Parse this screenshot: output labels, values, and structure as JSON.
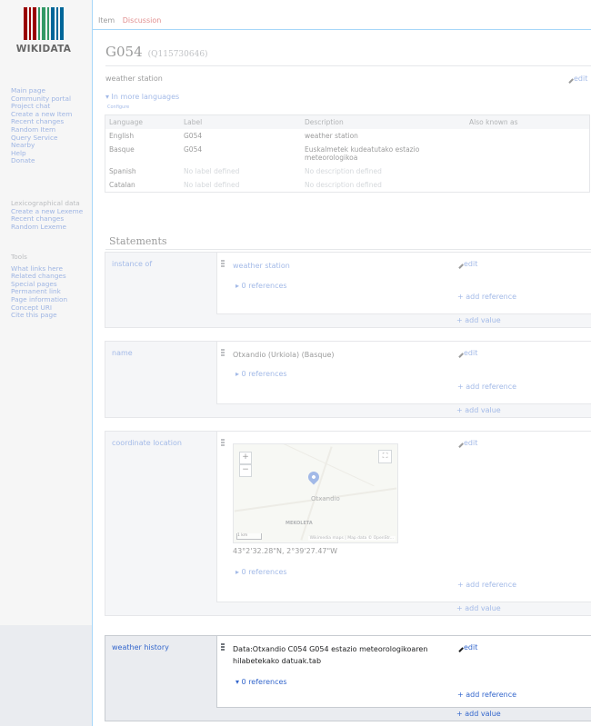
{
  "sidebar": {
    "logo_text": "WIKIDATA",
    "logo_colors": [
      "#990000",
      "#339966",
      "#006699"
    ],
    "nav_main": [
      "Main page",
      "Community portal",
      "Project chat",
      "Create a new Item",
      "Recent changes",
      "Random Item",
      "Query Service",
      "Nearby",
      "Help",
      "Donate"
    ],
    "lexico_heading": "Lexicographical data",
    "nav_lexico": [
      "Create a new Lexeme",
      "Recent changes",
      "Random Lexeme"
    ],
    "tools_heading": "Tools",
    "nav_tools": [
      "What links here",
      "Related changes",
      "Special pages",
      "Permanent link",
      "Page information",
      "Concept URI",
      "Cite this page"
    ]
  },
  "tabs": {
    "item": "Item",
    "discussion": "Discussion"
  },
  "header": {
    "label": "G054",
    "qid": "(Q115730646)"
  },
  "description": "weather station",
  "edit_label": "edit",
  "in_more_languages": "▾ In more languages",
  "configure": "Configure",
  "languages_table": {
    "headers": [
      "Language",
      "Label",
      "Description",
      "Also known as"
    ],
    "rows": [
      {
        "language": "English",
        "label": "G054",
        "description": "weather station",
        "aliases": ""
      },
      {
        "language": "Basque",
        "label": "G054",
        "description": "Euskalmetek kudeatutako estazio meteorologikoa",
        "aliases": ""
      },
      {
        "language": "Spanish",
        "label": "No label defined",
        "description": "No description defined",
        "aliases": ""
      },
      {
        "language": "Catalan",
        "label": "No label defined",
        "description": "No description defined",
        "aliases": ""
      }
    ]
  },
  "statements_heading": "Statements",
  "statements": {
    "instance_of": {
      "property": "instance of",
      "value": "weather station",
      "refs": "▸ 0 references"
    },
    "name": {
      "property": "name",
      "value": "Otxandio (Urkiola) (Basque)",
      "refs": "▸ 0 references"
    },
    "coordinate_location": {
      "property": "coordinate location",
      "value": "43°2'32.28\"N, 2°39'27.47\"W",
      "refs": "▸ 0 references",
      "map": {
        "town": "Otxandio",
        "town2": "MEKOLETA",
        "scale": "1 km",
        "attribution": "Wikimedia maps | Map data © OpenStr..."
      }
    },
    "weather_history": {
      "property": "weather history",
      "value": "Data:Otxandio C054 G054 estazio meteorologikoaren hilabetekako datuak.tab",
      "refs": "▾ 0 references"
    }
  },
  "add_reference": "+ add reference",
  "add_value": "+ add value"
}
